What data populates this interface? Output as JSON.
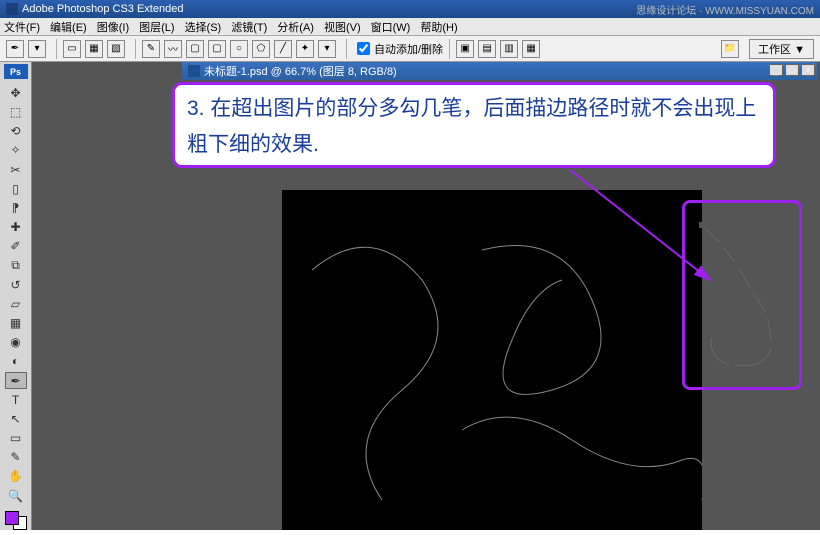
{
  "app": {
    "title": "Adobe Photoshop CS3 Extended",
    "watermark": "思缘设计论坛 · WWW.MISSYUAN.COM"
  },
  "menu": {
    "file": "文件(F)",
    "edit": "编辑(E)",
    "image": "图像(I)",
    "layer": "图层(L)",
    "select": "选择(S)",
    "filter": "滤镜(T)",
    "analysis": "分析(A)",
    "view": "视图(V)",
    "window": "窗口(W)",
    "help": "帮助(H)"
  },
  "toolbar": {
    "auto_add_delete_label": "自动添加/删除",
    "auto_add_delete_checked": true,
    "workspace_label": "工作区 ▼"
  },
  "toolbox": {
    "badge": "Ps",
    "tools": [
      "move",
      "marquee",
      "lasso",
      "wand",
      "crop",
      "slice",
      "eyedrop",
      "heal",
      "brush",
      "clone",
      "history",
      "eraser",
      "gradient",
      "blur",
      "dodge",
      "pen",
      "type",
      "path",
      "shape",
      "notes",
      "hand",
      "zoom"
    ],
    "fg_color": "#a020f0",
    "bg_color": "#ffffff"
  },
  "document": {
    "title": "未标题-1.psd @ 66.7% (图层 8, RGB/8)",
    "zoom": "66.7%"
  },
  "callout": {
    "text": "3. 在超出图片的部分多勾几笔，后面描边路径时就不会出现上粗下细的效果."
  }
}
